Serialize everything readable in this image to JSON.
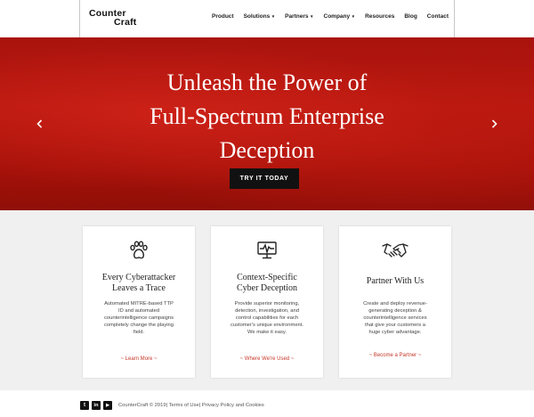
{
  "header": {
    "logo_line1": "Counter",
    "logo_line2": "Craft",
    "nav": [
      {
        "label": "Product",
        "dropdown": false
      },
      {
        "label": "Solutions",
        "dropdown": true
      },
      {
        "label": "Partners",
        "dropdown": true
      },
      {
        "label": "Company",
        "dropdown": true
      },
      {
        "label": "Resources",
        "dropdown": false
      },
      {
        "label": "Blog",
        "dropdown": false
      },
      {
        "label": "Contact",
        "dropdown": false
      }
    ]
  },
  "hero": {
    "title_lines": [
      "Unleash the Power of",
      "Full-Spectrum Enterprise",
      "Deception"
    ],
    "cta_label": "TRY IT TODAY",
    "prev_icon": "chevron-left-icon",
    "next_icon": "chevron-right-icon"
  },
  "cards": [
    {
      "icon": "paw-icon",
      "title_lines": [
        "Every Cyberattacker",
        "Leaves a Trace"
      ],
      "desc_lines": [
        "Automated MITRE-based TTP",
        "ID and automated",
        "counterintelligence campaigns",
        "completely change the playing",
        "field."
      ],
      "link": "~ Learn More ~"
    },
    {
      "icon": "monitor-pulse-icon",
      "title_lines": [
        "Context-Specific",
        "Cyber Deception"
      ],
      "desc_lines": [
        "Provide superior monitoring,",
        "detection, investigation, and",
        "control capabilities for each",
        "customer's unique environment.",
        "We make it easy."
      ],
      "link": "~ Where We're Used ~"
    },
    {
      "icon": "handshake-icon",
      "title_lines": [
        "Partner With Us"
      ],
      "desc_lines": [
        "Create and deploy revenue-",
        "generating deception &",
        "counterintelligence services",
        "that give your customers a",
        "huge cyber advantage."
      ],
      "link": "~ Become a Partner ~"
    }
  ],
  "footer": {
    "social": [
      {
        "icon": "twitter-icon",
        "glyph": "t"
      },
      {
        "icon": "linkedin-icon",
        "glyph": "in"
      },
      {
        "icon": "youtube-icon",
        "glyph": "▶"
      }
    ],
    "copyright": "CounterCraft © 2019|",
    "terms": " Terms of Use",
    "sep": "|",
    "privacy": " Privacy Policy and Cookies"
  }
}
